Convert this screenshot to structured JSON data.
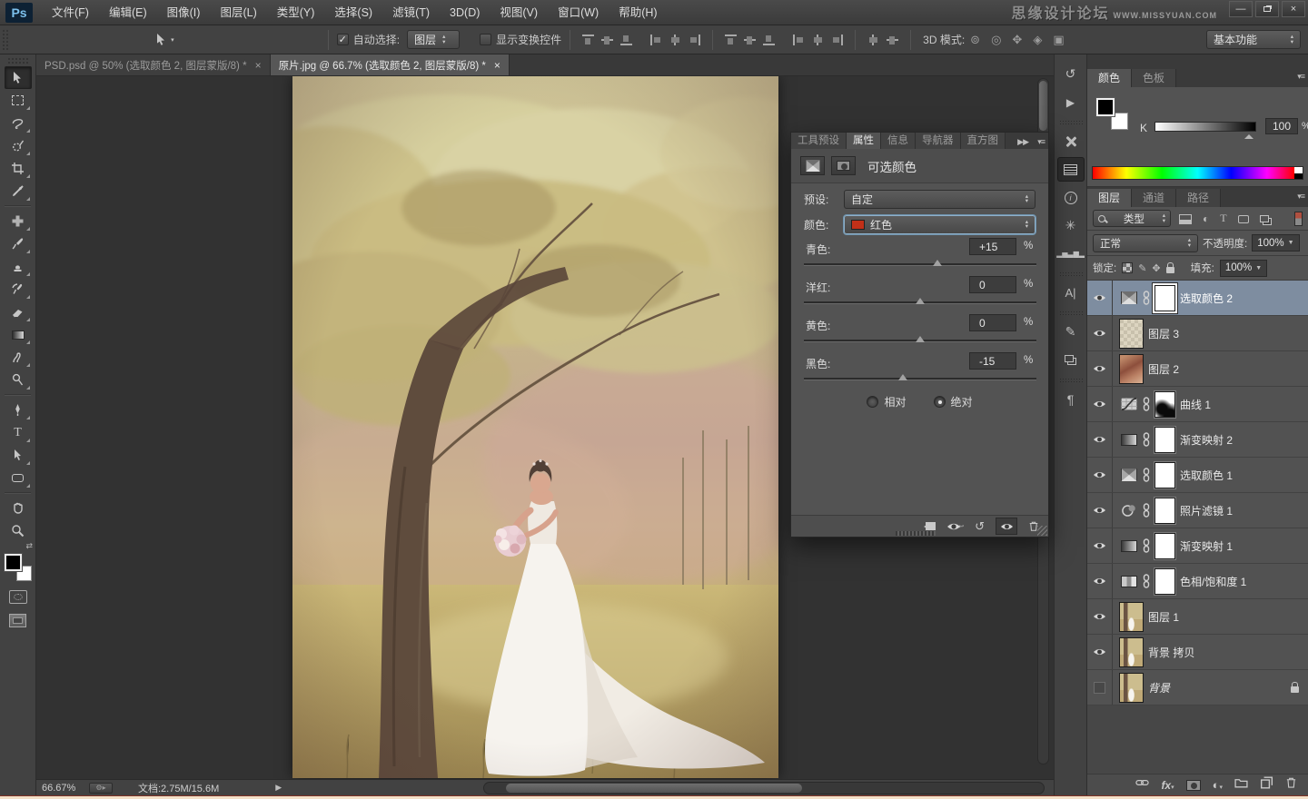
{
  "window": {
    "watermark_title": "思缘设计论坛",
    "watermark_url": "WWW.MISSYUAN.COM",
    "controls": {
      "minimize": "—",
      "close": "×"
    }
  },
  "menu": {
    "logo": "Ps",
    "items": [
      {
        "label": "文件(F)"
      },
      {
        "label": "编辑(E)"
      },
      {
        "label": "图像(I)"
      },
      {
        "label": "图层(L)"
      },
      {
        "label": "类型(Y)"
      },
      {
        "label": "选择(S)"
      },
      {
        "label": "滤镜(T)"
      },
      {
        "label": "3D(D)"
      },
      {
        "label": "视图(V)"
      },
      {
        "label": "窗口(W)"
      },
      {
        "label": "帮助(H)"
      }
    ]
  },
  "options": {
    "auto_select_label": "自动选择:",
    "auto_select_value": "图层",
    "check_glyph": "✓",
    "show_transform_label": "显示变换控件",
    "mode_3d_label": "3D 模式:",
    "workspace": "基本功能"
  },
  "doc_tabs": [
    {
      "title": "PSD.psd @ 50% (选取颜色 2, 图层蒙版/8) *",
      "close": "×",
      "active": false
    },
    {
      "title": "原片.jpg @ 66.7% (选取颜色 2, 图层蒙版/8) *",
      "close": "×",
      "active": true
    }
  ],
  "properties": {
    "tabs": [
      {
        "label": "工具预设"
      },
      {
        "label": "属性"
      },
      {
        "label": "信息"
      },
      {
        "label": "导航器"
      },
      {
        "label": "直方图"
      }
    ],
    "active_tab": "属性",
    "title": "可选颜色",
    "preset_label": "预设:",
    "preset_value": "自定",
    "color_label": "颜色:",
    "color_value": "红色",
    "color_swatch_hex": "#c23018",
    "sliders": [
      {
        "label": "青色:",
        "value": "+15",
        "unit": "%",
        "position_pct": 57.5
      },
      {
        "label": "洋红:",
        "value": "0",
        "unit": "%",
        "position_pct": 50
      },
      {
        "label": "黄色:",
        "value": "0",
        "unit": "%",
        "position_pct": 50
      },
      {
        "label": "黑色:",
        "value": "-15",
        "unit": "%",
        "position_pct": 42.5
      }
    ],
    "radio_relative": "相对",
    "radio_absolute": "绝对",
    "radio_selected": "绝对"
  },
  "color_panel": {
    "tabs": [
      {
        "label": "颜色"
      },
      {
        "label": "色板"
      }
    ],
    "active_tab": "颜色",
    "channel_label": "K",
    "value": "100",
    "unit": "%",
    "foreground_hex": "#000000",
    "background_hex": "#ffffff"
  },
  "layers": {
    "tabs": [
      {
        "label": "图层"
      },
      {
        "label": "通道"
      },
      {
        "label": "路径"
      }
    ],
    "active_tab": "图层",
    "filter_value": "类型",
    "blend_mode": "正常",
    "opacity_label": "不透明度:",
    "opacity_value": "100%",
    "lock_label": "锁定:",
    "fill_label": "填充:",
    "fill_value": "100%",
    "items": [
      {
        "name": "选取颜色 2",
        "kind": "selective-color",
        "visible": true,
        "selected": true
      },
      {
        "name": "图层 3",
        "kind": "image",
        "visible": true
      },
      {
        "name": "图层 2",
        "kind": "image",
        "visible": true
      },
      {
        "name": "曲线 1",
        "kind": "curves",
        "visible": true
      },
      {
        "name": "渐变映射 2",
        "kind": "gradient-map",
        "visible": true
      },
      {
        "name": "选取颜色 1",
        "kind": "selective-color",
        "visible": true
      },
      {
        "name": "照片滤镜 1",
        "kind": "photo-filter",
        "visible": true
      },
      {
        "name": "渐变映射 1",
        "kind": "gradient-map",
        "visible": true
      },
      {
        "name": "色相/饱和度 1",
        "kind": "hue-saturation",
        "visible": true
      },
      {
        "name": "图层 1",
        "kind": "image",
        "visible": true
      },
      {
        "name": "背景 拷贝",
        "kind": "image",
        "visible": true
      },
      {
        "name": "背景",
        "kind": "image",
        "visible": false,
        "locked": true
      }
    ]
  },
  "status": {
    "zoom": "66.67%",
    "doc_info": "文档:2.75M/15.6M"
  }
}
